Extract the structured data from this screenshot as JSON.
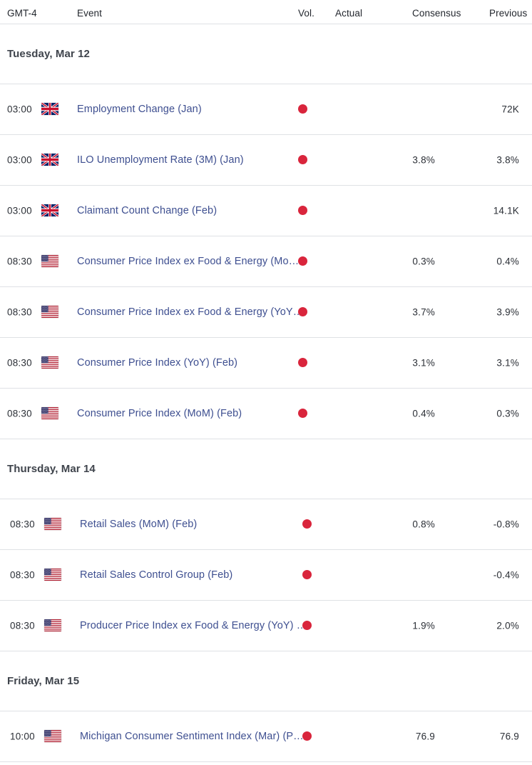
{
  "header": {
    "timezone": "GMT-4",
    "event": "Event",
    "vol": "Vol.",
    "actual": "Actual",
    "consensus": "Consensus",
    "previous": "Previous"
  },
  "colors": {
    "link": "#3e4f90",
    "high_volatility": "#d9253c",
    "border": "#dfe1e5",
    "day_header_text": "#3f444c",
    "value_text": "#2b2f36"
  },
  "days": [
    {
      "label": "Tuesday, Mar 12",
      "rows": [
        {
          "time": "03:00",
          "flag": "uk-flag",
          "country": "United Kingdom",
          "event": "Employment Change (Jan)",
          "volatility": "high",
          "actual": "",
          "consensus": "",
          "previous": "72K"
        },
        {
          "time": "03:00",
          "flag": "uk-flag",
          "country": "United Kingdom",
          "event": "ILO Unemployment Rate (3M) (Jan)",
          "volatility": "high",
          "actual": "",
          "consensus": "3.8%",
          "previous": "3.8%"
        },
        {
          "time": "03:00",
          "flag": "uk-flag",
          "country": "United Kingdom",
          "event": "Claimant Count Change (Feb)",
          "volatility": "high",
          "actual": "",
          "consensus": "",
          "previous": "14.1K"
        },
        {
          "time": "08:30",
          "flag": "us-flag",
          "country": "United States",
          "event": "Consumer Price Index ex Food & Energy (MoM) (Feb)",
          "volatility": "high",
          "actual": "",
          "consensus": "0.3%",
          "previous": "0.4%"
        },
        {
          "time": "08:30",
          "flag": "us-flag",
          "country": "United States",
          "event": "Consumer Price Index ex Food & Energy (YoY) (Feb)",
          "volatility": "high",
          "actual": "",
          "consensus": "3.7%",
          "previous": "3.9%"
        },
        {
          "time": "08:30",
          "flag": "us-flag",
          "country": "United States",
          "event": "Consumer Price Index (YoY) (Feb)",
          "volatility": "high",
          "actual": "",
          "consensus": "3.1%",
          "previous": "3.1%"
        },
        {
          "time": "08:30",
          "flag": "us-flag",
          "country": "United States",
          "event": "Consumer Price Index (MoM) (Feb)",
          "volatility": "high",
          "actual": "",
          "consensus": "0.4%",
          "previous": "0.3%"
        }
      ]
    },
    {
      "label": "Thursday, Mar 14",
      "rows": [
        {
          "time": "08:30",
          "flag": "us-flag",
          "country": "United States",
          "event": "Retail Sales (MoM) (Feb)",
          "volatility": "high",
          "actual": "",
          "consensus": "0.8%",
          "previous": "-0.8%"
        },
        {
          "time": "08:30",
          "flag": "us-flag",
          "country": "United States",
          "event": "Retail Sales Control Group (Feb)",
          "volatility": "high",
          "actual": "",
          "consensus": "",
          "previous": "-0.4%"
        },
        {
          "time": "08:30",
          "flag": "us-flag",
          "country": "United States",
          "event": "Producer Price Index ex Food & Energy (YoY) (Feb)",
          "volatility": "high",
          "actual": "",
          "consensus": "1.9%",
          "previous": "2.0%"
        }
      ]
    },
    {
      "label": "Friday, Mar 15",
      "rows": [
        {
          "time": "10:00",
          "flag": "us-flag",
          "country": "United States",
          "event": "Michigan Consumer Sentiment Index (Mar) (PREL)",
          "volatility": "high",
          "actual": "",
          "consensus": "76.9",
          "previous": "76.9"
        }
      ]
    }
  ]
}
